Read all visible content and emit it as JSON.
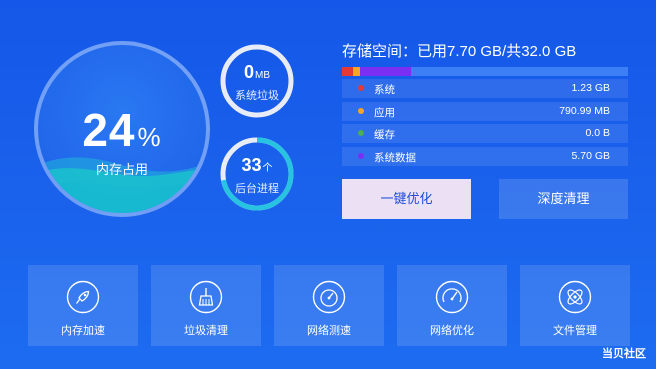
{
  "memory": {
    "value": "24",
    "unit": "%",
    "label": "内存占用"
  },
  "junk": {
    "value": "0",
    "unit": "MB",
    "label": "系统垃圾"
  },
  "processes": {
    "value": "33",
    "unit": "个",
    "label": "后台进程",
    "progress": 0.72
  },
  "storage": {
    "title": "存储空间：已用7.70 GB/共32.0 GB",
    "used_gb": 7.7,
    "total_gb": 32.0,
    "items": [
      {
        "name": "系统",
        "value": "1.23 GB",
        "gb": 1.23,
        "color": "#e53935"
      },
      {
        "name": "应用",
        "value": "790.99 MB",
        "gb": 0.79,
        "color": "#f5a623"
      },
      {
        "name": "缓存",
        "value": "0.0 B",
        "gb": 0.0,
        "color": "#4caf50"
      },
      {
        "name": "系统数据",
        "value": "5.70 GB",
        "gb": 5.7,
        "color": "#7b2ff2"
      }
    ]
  },
  "buttons": {
    "optimize": "一键优化",
    "deep_clean": "深度清理"
  },
  "tiles": [
    {
      "label": "内存加速",
      "icon": "rocket-icon"
    },
    {
      "label": "垃圾清理",
      "icon": "broom-icon"
    },
    {
      "label": "网络测速",
      "icon": "speedometer-icon"
    },
    {
      "label": "网络优化",
      "icon": "gauge-icon"
    },
    {
      "label": "文件管理",
      "icon": "atom-icon"
    }
  ],
  "watermark": "当贝社区"
}
